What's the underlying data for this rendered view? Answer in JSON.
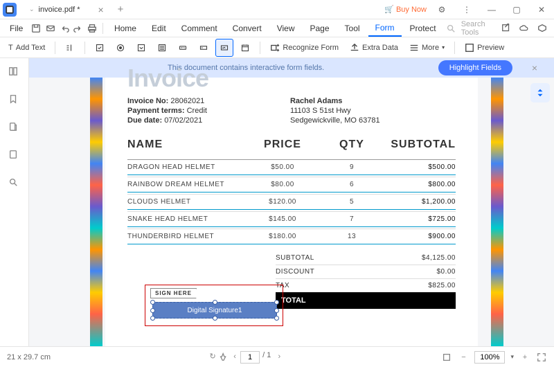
{
  "titlebar": {
    "tab_name": "invoice.pdf *",
    "buy_now": "Buy Now"
  },
  "menubar": {
    "file": "File",
    "items": [
      "Home",
      "Edit",
      "Comment",
      "Convert",
      "View",
      "Page",
      "Tool",
      "Form",
      "Protect"
    ],
    "active": "Form",
    "search_placeholder": "Search Tools"
  },
  "toolbar": {
    "add_text": "Add Text",
    "recognize_form": "Recognize Form",
    "extra_data": "Extra Data",
    "more": "More",
    "preview": "Preview"
  },
  "infobar": {
    "text": "This document contains interactive form fields.",
    "highlight_btn": "Highlight Fields"
  },
  "invoice": {
    "title": "Invoice",
    "invoice_no_label": "Invoice No:",
    "invoice_no": "28062021",
    "payment_terms_label": "Payment terms:",
    "payment_terms": "Credit",
    "due_date_label": "Due date:",
    "due_date": "07/02/2021",
    "customer_name": "Rachel Adams",
    "addr1": "11103 S 51st Hwy",
    "addr2": "Sedgewickville, MO 63781",
    "headers": {
      "name": "NAME",
      "price": "PRICE",
      "qty": "QTY",
      "subtotal": "SUBTOTAL"
    },
    "rows": [
      {
        "name": "DRAGON HEAD HELMET",
        "price": "$50.00",
        "qty": "9",
        "subtotal": "$500.00"
      },
      {
        "name": "RAINBOW DREAM HELMET",
        "price": "$80.00",
        "qty": "6",
        "subtotal": "$800.00"
      },
      {
        "name": "CLOUDS HELMET",
        "price": "$120.00",
        "qty": "5",
        "subtotal": "$1,200.00"
      },
      {
        "name": "SNAKE HEAD HELMET",
        "price": "$145.00",
        "qty": "7",
        "subtotal": "$725.00"
      },
      {
        "name": "THUNDERBIRD HELMET",
        "price": "$180.00",
        "qty": "13",
        "subtotal": "$900.00"
      }
    ],
    "totals": {
      "subtotal_label": "SUBTOTAL",
      "subtotal": "$4,125.00",
      "discount_label": "DISCOUNT",
      "discount": "$0.00",
      "tax_label": "TAX",
      "tax": "$825.00",
      "total_label": "TOTAL"
    },
    "sign_here": "SIGN HERE",
    "sig_field": "Digital Signature1"
  },
  "statusbar": {
    "dimensions": "21 x 29.7 cm",
    "page": "1",
    "total_pages": "/ 1",
    "zoom": "100%"
  }
}
